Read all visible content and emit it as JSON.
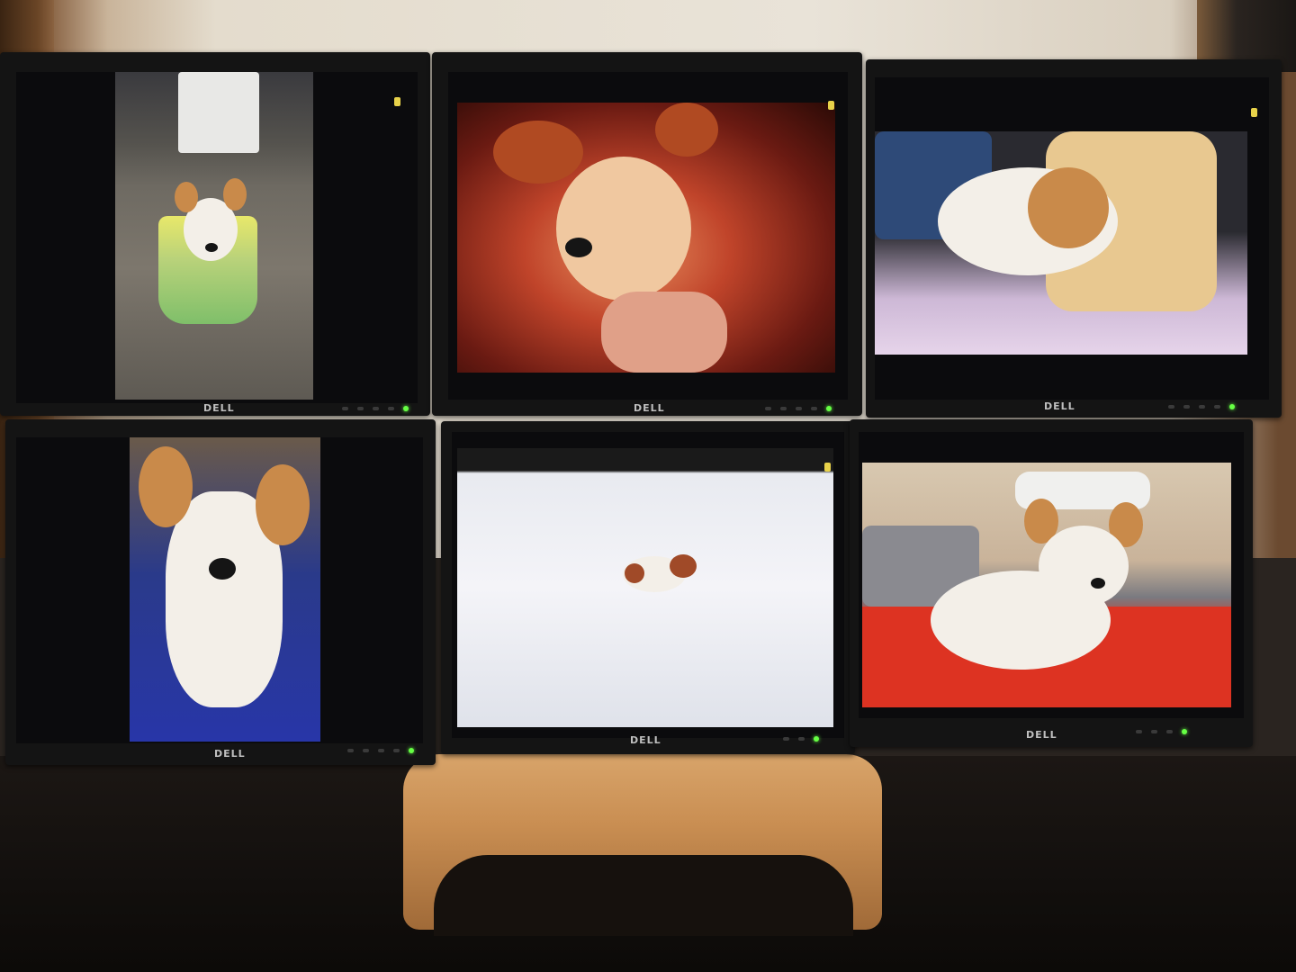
{
  "scene": {
    "brand_label": "DELL",
    "colors": {
      "power_led": "#66ff44",
      "osd_indicator": "#e8d24a",
      "bezel": "#141414",
      "stand_wood": "#c98e52"
    }
  },
  "monitors": [
    {
      "position": "top-left",
      "brand": "DELL",
      "photo": "dog-in-sunflower-bucket"
    },
    {
      "position": "top-center",
      "brand": "DELL",
      "photo": "dog-closeup-red-light"
    },
    {
      "position": "top-right",
      "brand": "DELL",
      "photo": "dog-sleeping-on-blanket"
    },
    {
      "position": "bottom-left",
      "brand": "DELL",
      "photo": "dog-looking-up-blue"
    },
    {
      "position": "bottom-center",
      "brand": "DELL",
      "photo": "dog-in-snow"
    },
    {
      "position": "bottom-right",
      "brand": "DELL",
      "photo": "dog-on-red-blanket"
    }
  ]
}
